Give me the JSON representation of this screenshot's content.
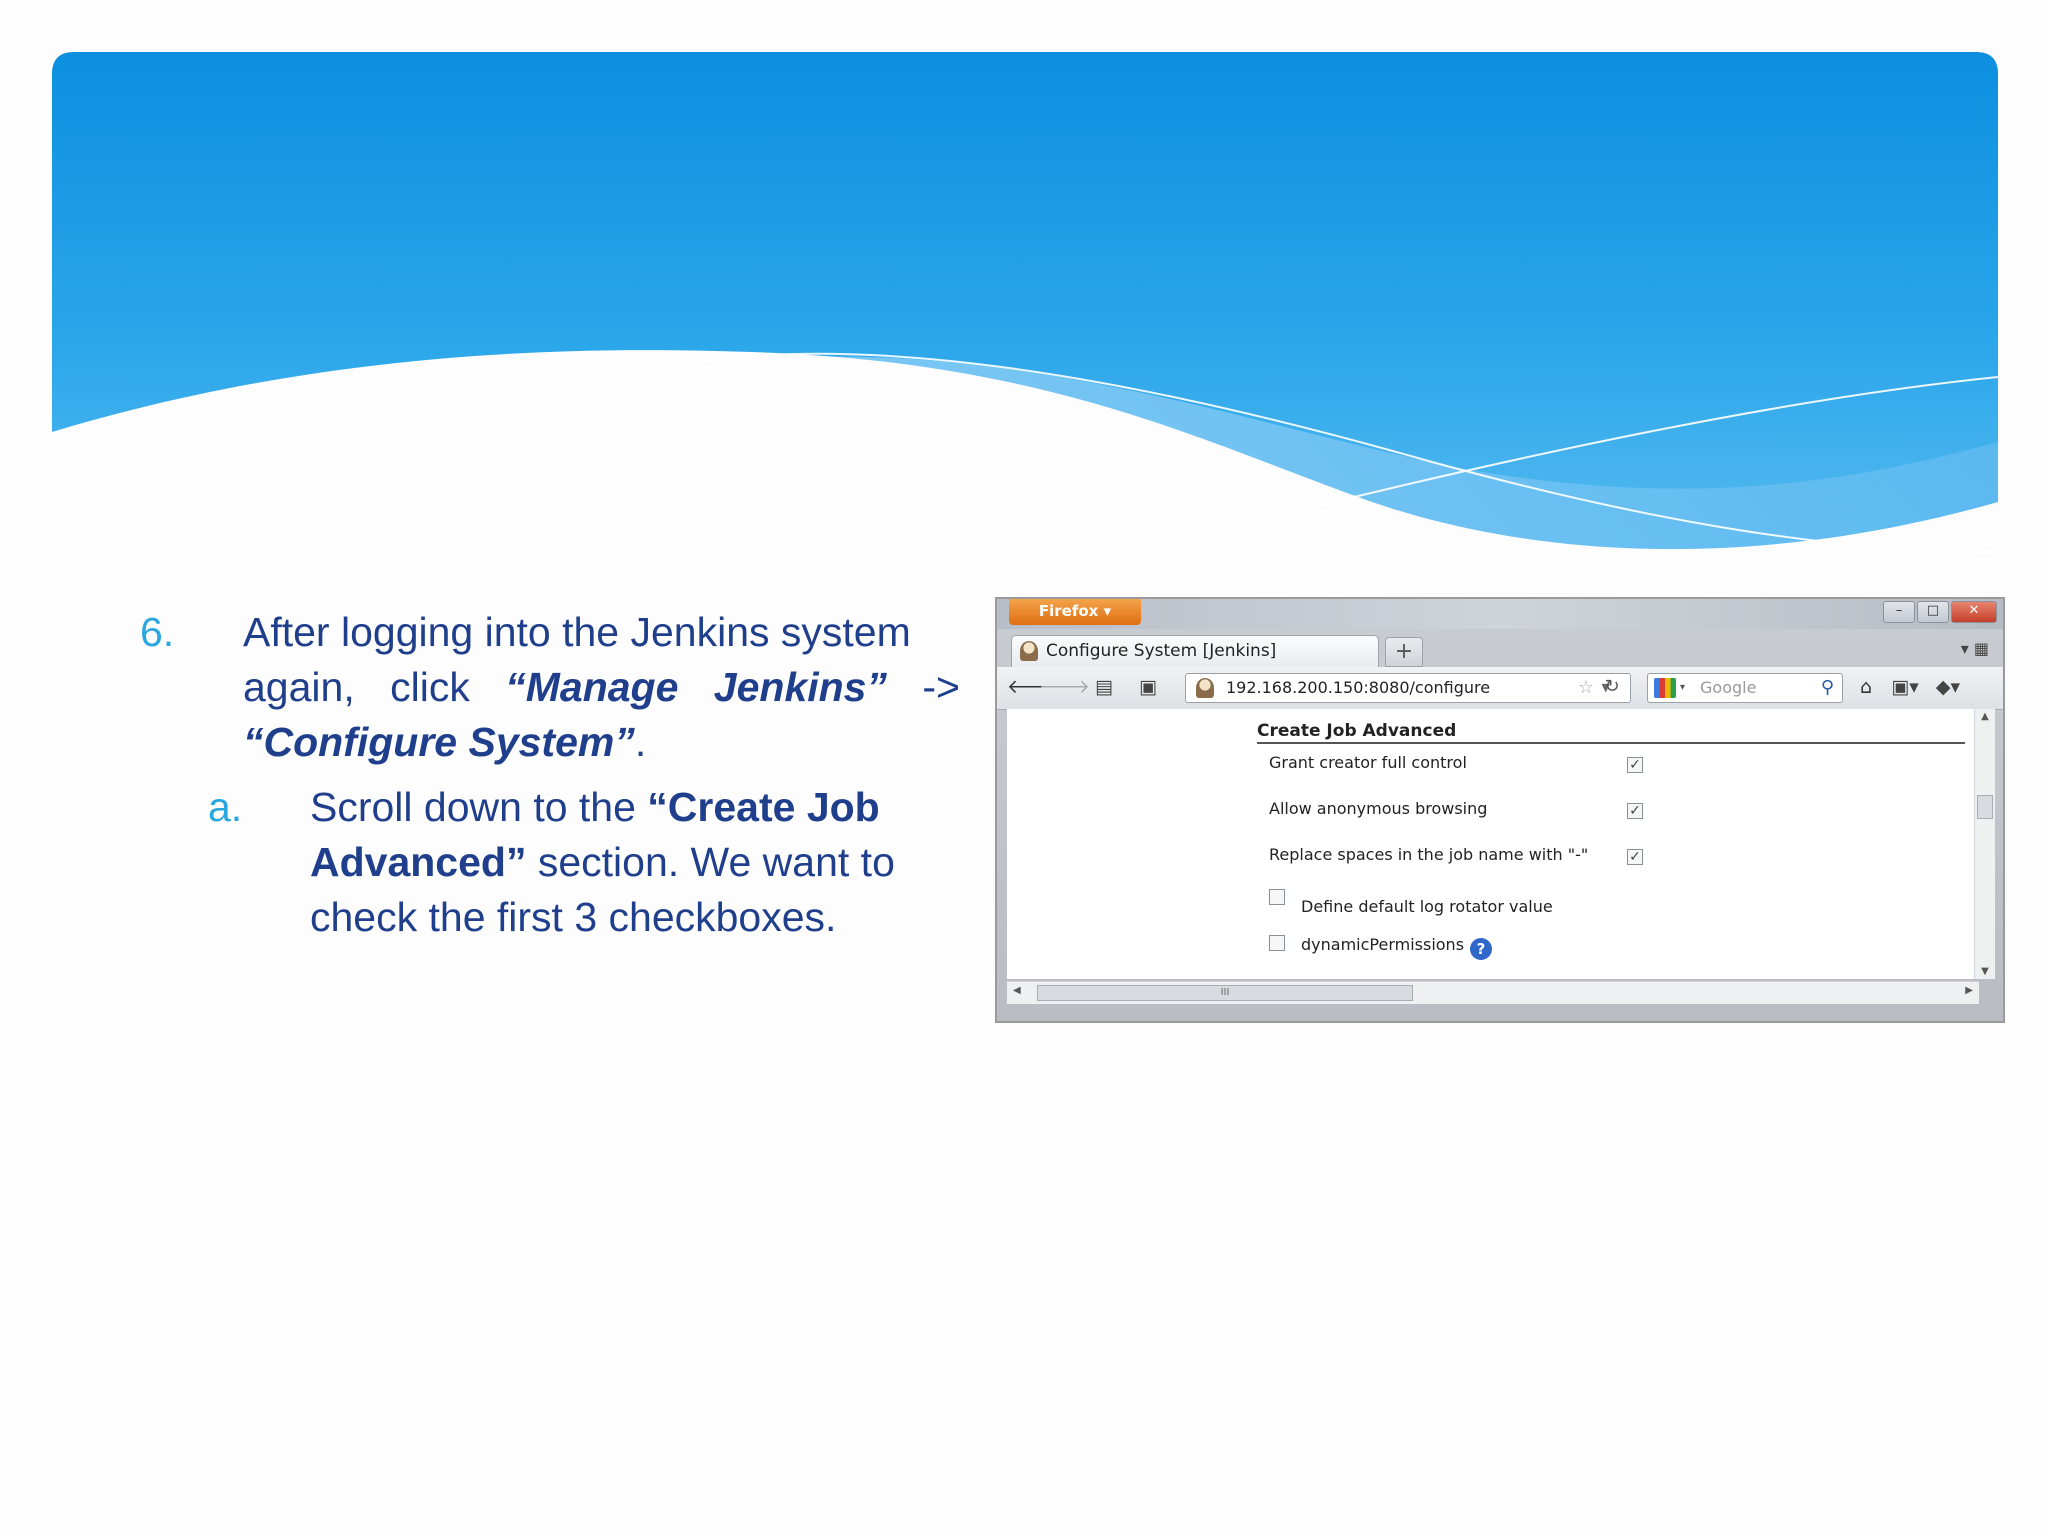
{
  "slide": {
    "item": {
      "number": "6.",
      "line1": "After logging into the Jenkins system",
      "again": "again,",
      "click": "click",
      "manage_jenkins": "“Manage Jenkins”",
      "arrow": "->",
      "configure_system": "“Configure System”",
      "period": "."
    },
    "subitem": {
      "letter": "a.",
      "text_prefix": "Scroll down to the ",
      "create_job_advanced": "“Create Job Advanced”",
      "text_suffix": " section.  We want to check the first 3 checkboxes."
    }
  },
  "browser": {
    "app_button": "Firefox",
    "tab_title": "Configure System [Jenkins]",
    "new_tab_label": "+",
    "url": "192.168.200.150:8080/configure",
    "search_placeholder": "Google",
    "window_buttons": [
      "–",
      "□",
      "✕"
    ],
    "section_title": "Create Job Advanced",
    "options": [
      {
        "label": "Grant creator full control",
        "checked": true
      },
      {
        "label": "Allow anonymous browsing",
        "checked": true
      },
      {
        "label": "Replace spaces in the job name with \"-\"",
        "checked": true
      },
      {
        "label": "Define default log rotator value",
        "checked": false
      },
      {
        "label": "dynamicPermissions",
        "checked": false
      }
    ],
    "help_icon_glyph": "?",
    "scroll_grip": "III"
  },
  "colors": {
    "header_blue": "#1a9be6",
    "text_navy": "#1f3f8c",
    "number_cyan": "#29a8e0",
    "firefox_orange": "#e8821e"
  }
}
